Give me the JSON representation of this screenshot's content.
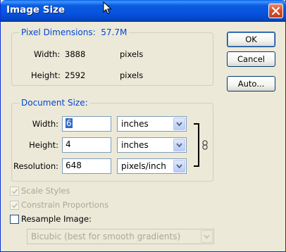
{
  "window": {
    "title": "Image Size"
  },
  "icons": {
    "close": "close-icon",
    "cursor": "mouse-cursor-icon",
    "link": "chain-link-icon",
    "dropdown": "chevron-down-icon",
    "check": "checkmark-icon"
  },
  "pixel_dimensions": {
    "label": "Pixel Dimensions:",
    "size": "57.7M",
    "width_label": "Width:",
    "width_value": "3888",
    "width_unit": "pixels",
    "height_label": "Height:",
    "height_value": "2592",
    "height_unit": "pixels"
  },
  "document_size": {
    "label": "Document Size:",
    "width_label": "Width:",
    "width_value": "6",
    "width_unit": "inches",
    "height_label": "Height:",
    "height_value": "4",
    "height_unit": "inches",
    "resolution_label": "Resolution:",
    "resolution_value": "648",
    "resolution_unit": "pixels/inch"
  },
  "options": {
    "scale_styles": {
      "label": "Scale Styles",
      "checked": true,
      "enabled": false
    },
    "constrain_proportions": {
      "label": "Constrain Proportions",
      "checked": true,
      "enabled": false
    },
    "resample_image": {
      "label": "Resample Image:",
      "checked": false,
      "enabled": true
    },
    "resample_method": "Bicubic (best for smooth gradients)"
  },
  "buttons": {
    "ok": "OK",
    "cancel": "Cancel",
    "auto": "Auto..."
  },
  "colors": {
    "title_bar": "#0653e0",
    "group_label": "#0046d5",
    "dialog_bg": "#ece9d8"
  }
}
